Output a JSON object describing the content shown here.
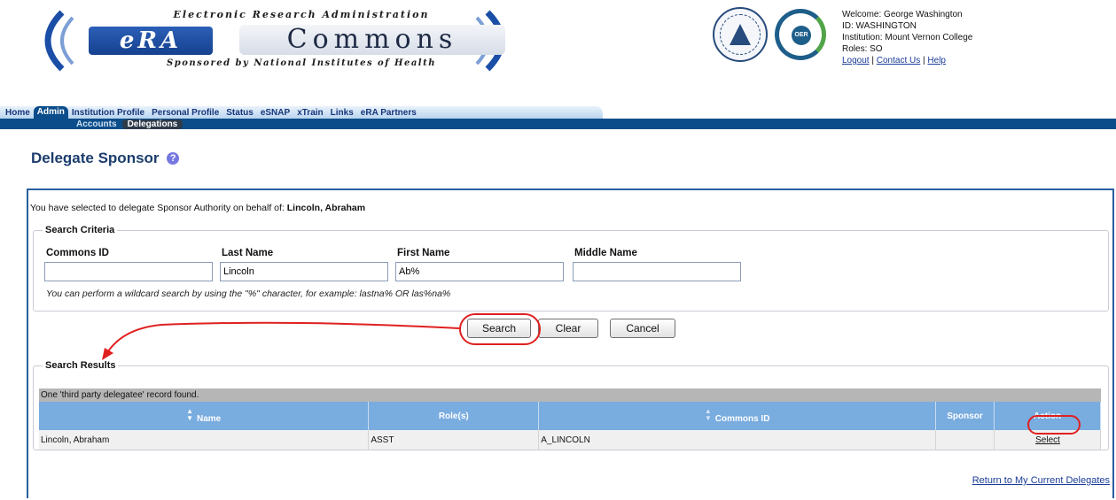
{
  "header": {
    "logo_top": "Electronic Research Administration",
    "logo_era": "eRA",
    "logo_commons": "Commons",
    "logo_bottom": "Sponsored by National Institutes of Health",
    "oer_label": "OER"
  },
  "welcome": {
    "line1": "Welcome: George Washington",
    "line2": "ID: WASHINGTON",
    "line3": "Institution: Mount Vernon College",
    "line4": "Roles:  SO",
    "logout": "Logout",
    "contact": "Contact Us",
    "help": "Help",
    "separator": "|"
  },
  "nav": {
    "primary": [
      "Home",
      "Admin",
      "Institution Profile",
      "Personal Profile",
      "Status",
      "eSNAP",
      "xTrain",
      "Links",
      "eRA Partners"
    ],
    "active_primary": "Admin",
    "secondary": [
      "Accounts",
      "Delegations"
    ],
    "active_secondary": "Delegations"
  },
  "page": {
    "title": "Delegate Sponsor",
    "help_icon": "?"
  },
  "statement": {
    "prefix": "You have selected to delegate Sponsor Authority on behalf of: ",
    "name": "Lincoln, Abraham"
  },
  "criteria": {
    "legend": "Search Criteria",
    "commons_id_label": "Commons ID",
    "commons_id_value": "",
    "last_name_label": "Last Name",
    "last_name_value": "Lincoln",
    "first_name_label": "First Name",
    "first_name_value": "Ab%",
    "middle_name_label": "Middle Name",
    "middle_name_value": "",
    "hint": "You can perform a wildcard search by using the \"%\" character, for example: lastna% OR las%na%"
  },
  "buttons": {
    "search": "Search",
    "clear": "Clear",
    "cancel": "Cancel"
  },
  "results": {
    "legend": "Search Results",
    "count_text": "One 'third party delegatee' record found.",
    "columns": [
      "Name",
      "Role(s)",
      "Commons ID",
      "Sponsor",
      "Action"
    ],
    "rows": [
      {
        "name": "Lincoln, Abraham",
        "roles": "ASST",
        "commons_id": "A_LINCOLN",
        "sponsor": "",
        "action": "Select"
      }
    ]
  },
  "footer": {
    "return_link": "Return to My Current Delegates"
  },
  "colors": {
    "accent": "#0b4d8a",
    "panel_border": "#295e9f",
    "table_header": "#79acdf",
    "annotation": "#e02020"
  }
}
